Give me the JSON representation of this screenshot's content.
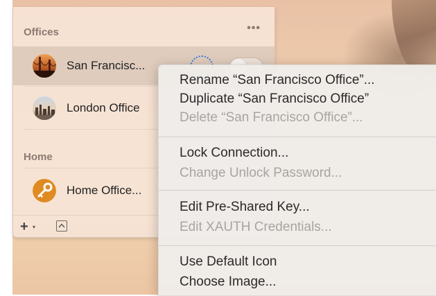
{
  "sidebar": {
    "sections": [
      {
        "title": "Offices",
        "more": "•••"
      },
      {
        "title": "Home"
      }
    ],
    "items": [
      {
        "label": "San Francisc..."
      },
      {
        "label": "London Office"
      },
      {
        "label": "Home Office..."
      }
    ]
  },
  "toolbar": {
    "add": "+",
    "caret": "▾"
  },
  "context_menu": {
    "items": [
      {
        "label": "Rename “San Francisco Office”...",
        "enabled": true
      },
      {
        "label": "Duplicate “San Francisco Office”",
        "enabled": true
      },
      {
        "label": "Delete “San Francisco Office”...",
        "enabled": false
      },
      {
        "label": "Lock Connection...",
        "enabled": true
      },
      {
        "label": "Change Unlock Password...",
        "enabled": false
      },
      {
        "label": "Edit Pre-Shared Key...",
        "enabled": true
      },
      {
        "label": "Edit XAUTH Credentials...",
        "enabled": false
      },
      {
        "label": "Use Default Icon",
        "enabled": true
      },
      {
        "label": "Choose Image...",
        "enabled": true
      }
    ]
  },
  "icons": {
    "san_francisco": "golden-gate-photo-icon",
    "london": "london-skyline-photo-icon",
    "home": "key-icon",
    "spinner": "connecting-spinner-icon",
    "collapse": "collapse-icon"
  },
  "colors": {
    "accent": "#3c7be0"
  }
}
